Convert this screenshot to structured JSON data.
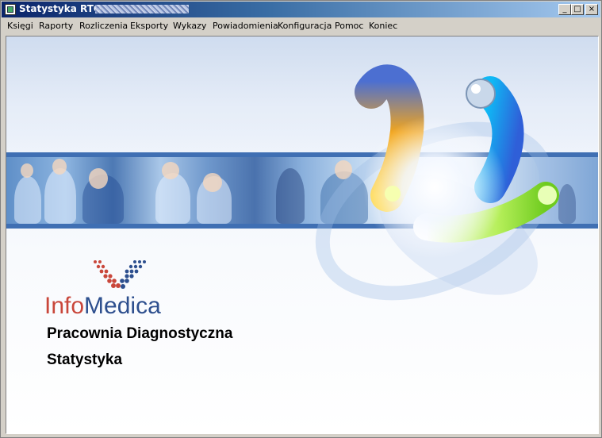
{
  "window": {
    "title": "Statystyka RTG",
    "controls": {
      "minimize": "_",
      "maximize": "□",
      "close": "×"
    }
  },
  "menu": {
    "items": [
      "Księgi",
      "Raporty",
      "Rozliczenia",
      "Eksporty",
      "Wykazy",
      "Powiadomienia",
      "Konfiguracja",
      "Pomoc",
      "Koniec"
    ]
  },
  "splash": {
    "logo_info": "Info",
    "logo_medica": "Medica",
    "application_name": "Pracownia Diagnostyczna",
    "module_name": "Statystyka"
  },
  "colors": {
    "title_bar": "#0a246a",
    "logo_red": "#c9473b",
    "logo_blue": "#2d4f8e",
    "photo_strip": "#3f6fb3"
  },
  "icons": {
    "window_icon": "app-window-icon"
  }
}
